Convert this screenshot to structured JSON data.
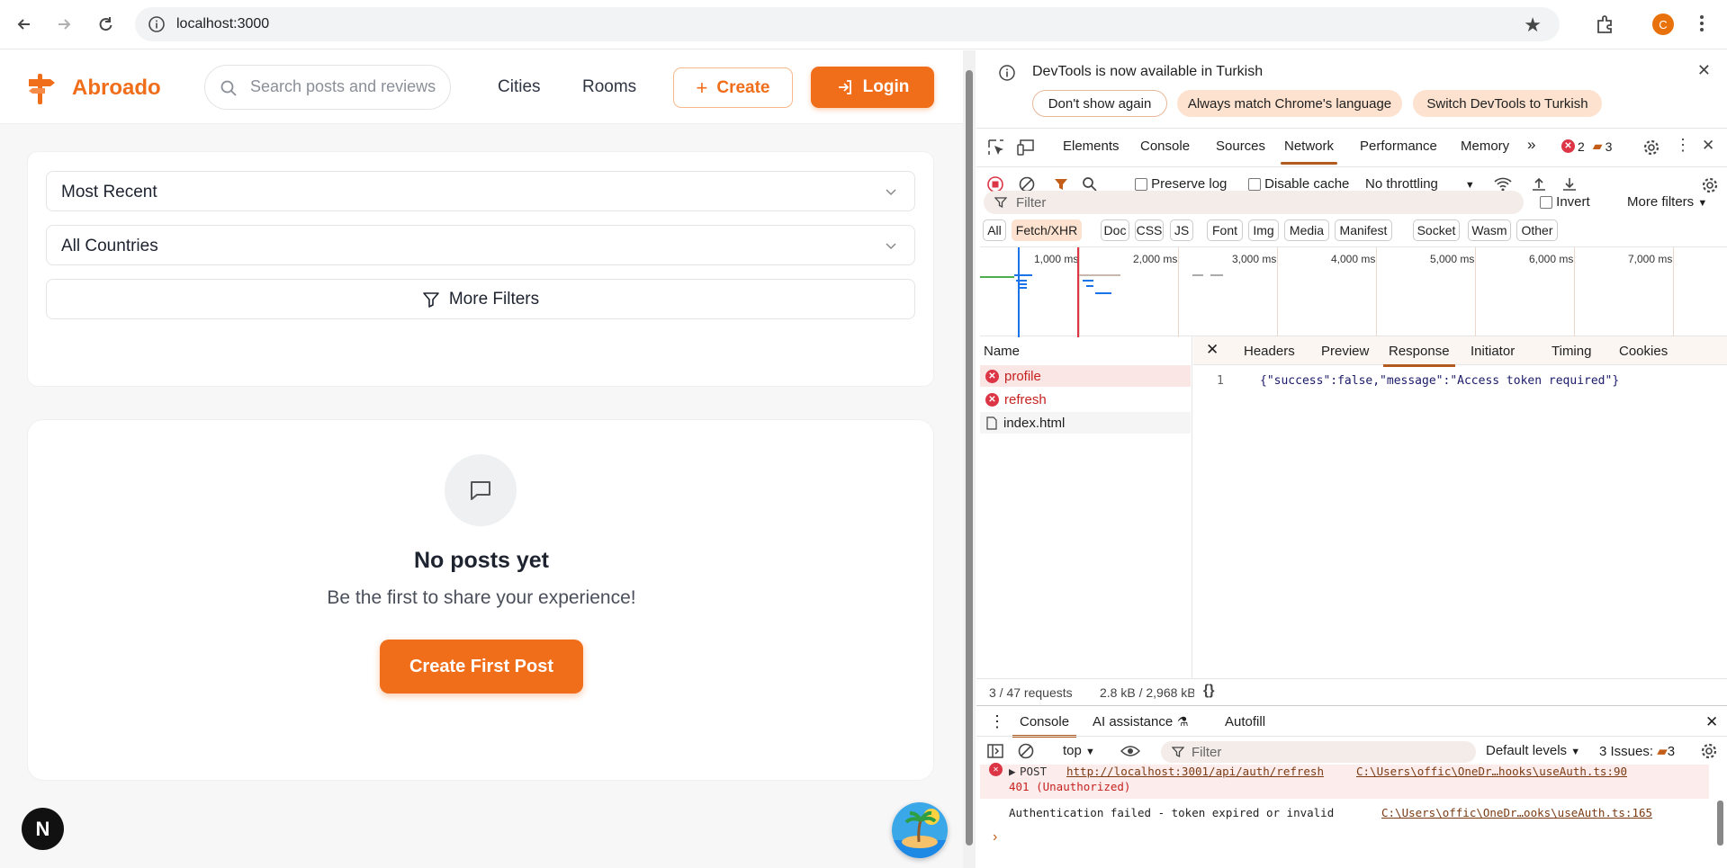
{
  "browser": {
    "url": "localhost:3000",
    "profile_initial": "C"
  },
  "app": {
    "brand": "Abroado",
    "search_placeholder": "Search posts and reviews",
    "nav": [
      "Cities",
      "Rooms"
    ],
    "create_label": "Create",
    "login_label": "Login",
    "sort_value": "Most Recent",
    "country_value": "All Countries",
    "more_filters_label": "More Filters",
    "empty_title": "No posts yet",
    "empty_subtitle": "Be the first to share your experience!",
    "create_first_label": "Create First Post",
    "next_badge": "N"
  },
  "devtools": {
    "banner": {
      "message": "DevTools is now available in Turkish",
      "dont_show": "Don't show again",
      "match_language": "Always match Chrome's language",
      "switch": "Switch DevTools to Turkish"
    },
    "tabs": [
      "Elements",
      "Console",
      "Sources",
      "Network",
      "Performance",
      "Memory"
    ],
    "active_tab": "Network",
    "errors_count": "2",
    "messages_count": "3",
    "toolbar": {
      "preserve_log": "Preserve log",
      "disable_cache": "Disable cache",
      "throttling": "No throttling"
    },
    "filter_placeholder": "Filter",
    "invert_label": "Invert",
    "more_filters_label": "More filters",
    "type_filters": [
      "All",
      "Fetch/XHR",
      "Doc",
      "CSS",
      "JS",
      "Font",
      "Img",
      "Media",
      "Manifest",
      "Socket",
      "Wasm",
      "Other"
    ],
    "timeline_labels": [
      "1,000 ms",
      "2,000 ms",
      "3,000 ms",
      "4,000 ms",
      "5,000 ms",
      "6,000 ms",
      "7,000 ms"
    ],
    "name_header": "Name",
    "requests": [
      {
        "name": "profile",
        "status": "error"
      },
      {
        "name": "refresh",
        "status": "error"
      },
      {
        "name": "index.html",
        "status": "ok"
      }
    ],
    "detail_tabs": [
      "Headers",
      "Preview",
      "Response",
      "Initiator",
      "Timing",
      "Cookies"
    ],
    "active_detail_tab": "Response",
    "response_line_no": "1",
    "response_body": "{\"success\":false,\"message\":\"Access token required\"}",
    "status_requests": "3 / 47 requests",
    "status_transferred": "2.8 kB / 2,968 kB",
    "drawer_tabs": [
      "Console",
      "AI assistance",
      "Autofill"
    ],
    "console_context": "top",
    "console_filter_placeholder": "Filter",
    "console_levels": "Default levels",
    "console_issues": "3 Issues:",
    "console_issues_count": "3",
    "console_messages": [
      {
        "method": "POST",
        "url": "http://localhost:3001/api/auth/refresh",
        "status": "401 (Unauthorized)",
        "source": "C:\\Users\\offic\\OneDr…hooks\\useAuth.ts:90"
      },
      {
        "text": "Authentication failed - token expired or invalid",
        "source": "C:\\Users\\offic\\OneDr…ooks\\useAuth.ts:165"
      }
    ]
  },
  "colors": {
    "brand": "#f06d1a",
    "devtools_accent": "#b35a1f",
    "error": "#dc3545"
  }
}
